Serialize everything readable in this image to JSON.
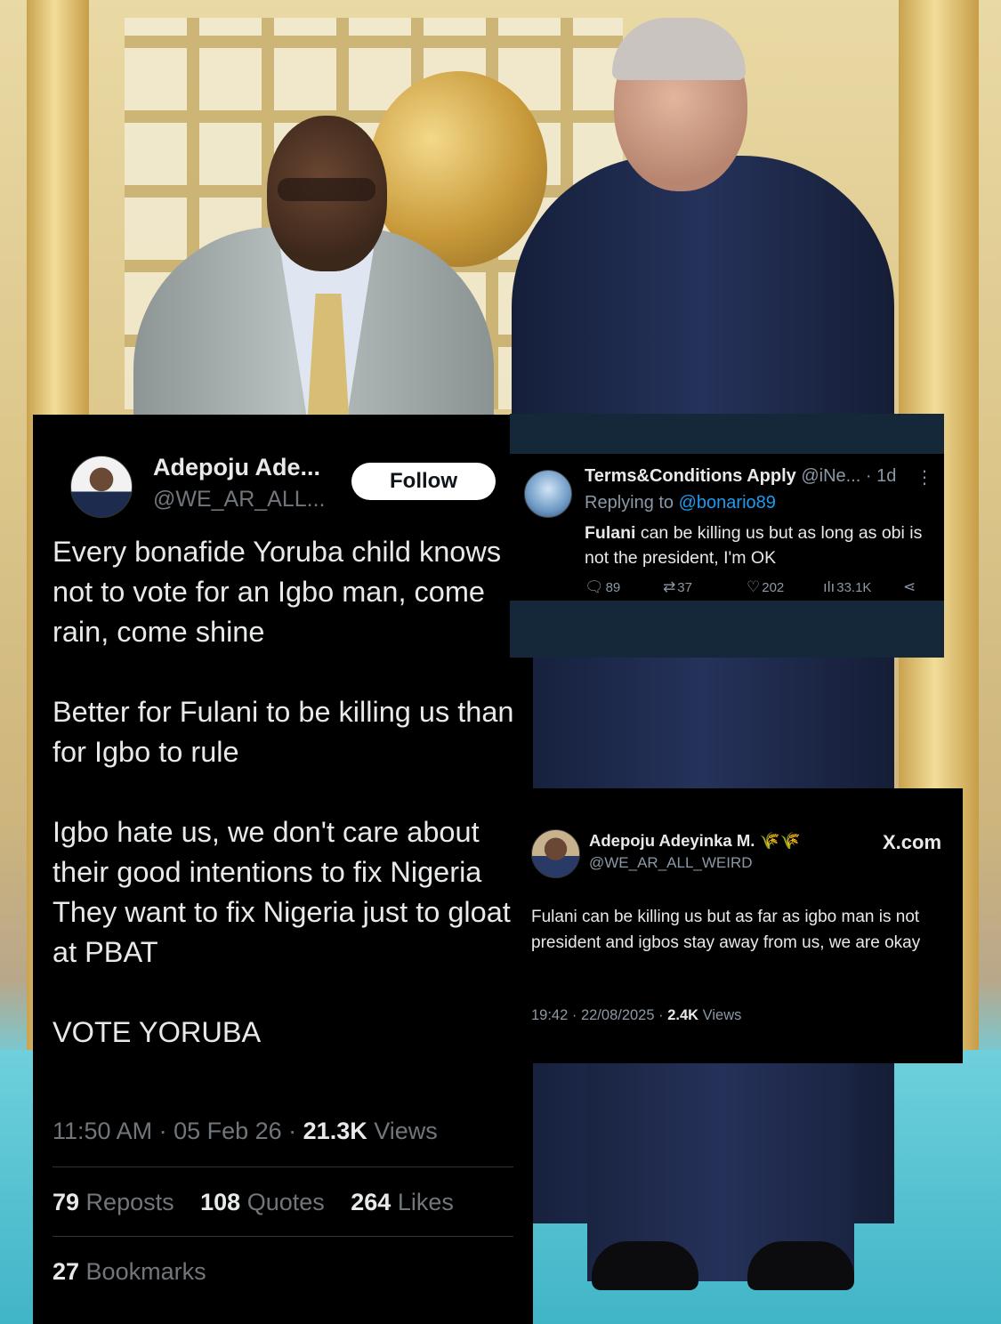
{
  "tweet_main": {
    "name": "Adepoju Ade...",
    "handle": "@WE_AR_ALL...",
    "follow_label": "Follow",
    "kebab": "⋮",
    "paragraphs": [
      "Every bonafide Yoruba child knows not to vote for an Igbo man, come rain, come shine",
      "Better for Fulani to be killing us than for Igbo to rule",
      "Igbo hate us, we don't care about their good intentions to fix Nigeria\nThey want to fix Nigeria just to gloat at PBAT",
      "VOTE YORUBA"
    ],
    "time": "11:50 AM · 05 Feb 26 · ",
    "views_count": "21.3K",
    "views_label": " Views",
    "reposts_count": "79",
    "reposts_label": " Reposts",
    "quotes_count": "108",
    "quotes_label": " Quotes",
    "likes_count": "264",
    "likes_label": " Likes",
    "bookmarks_count": "27",
    "bookmarks_label": " Bookmarks"
  },
  "tweet_reply": {
    "name": "Terms&Conditions Apply",
    "handle_time": " @iNe... · 1d",
    "kebab": "⋮",
    "replying_prefix": "Replying to ",
    "replying_to": "@bonario89",
    "text_bold": "Fulani",
    "text_rest": " can be killing us but as long as obi is not the president, I'm OK",
    "replies": "89",
    "reposts": "37",
    "likes": "202",
    "views": "33.1K"
  },
  "tweet_quote": {
    "name": "Adepoju Adeyinka M.",
    "emoji": "🌾🌾",
    "handle": "@WE_AR_ALL_WEIRD",
    "brand": "X.com",
    "text": "Fulani can be killing us but as far as igbo man is not president and igbos stay away from us, we are okay",
    "time": "19:42 · 22/08/2025 · ",
    "views_count": "2.4K",
    "views_label": " Views"
  },
  "icons": {
    "reply": "reply-icon",
    "repost": "repost-icon",
    "like": "heart-icon",
    "views": "views-icon",
    "share": "share-icon"
  },
  "colors": {
    "x_blue": "#1d9bf0",
    "dim_background": "#15202b",
    "carpet": "#5ec0cf"
  }
}
